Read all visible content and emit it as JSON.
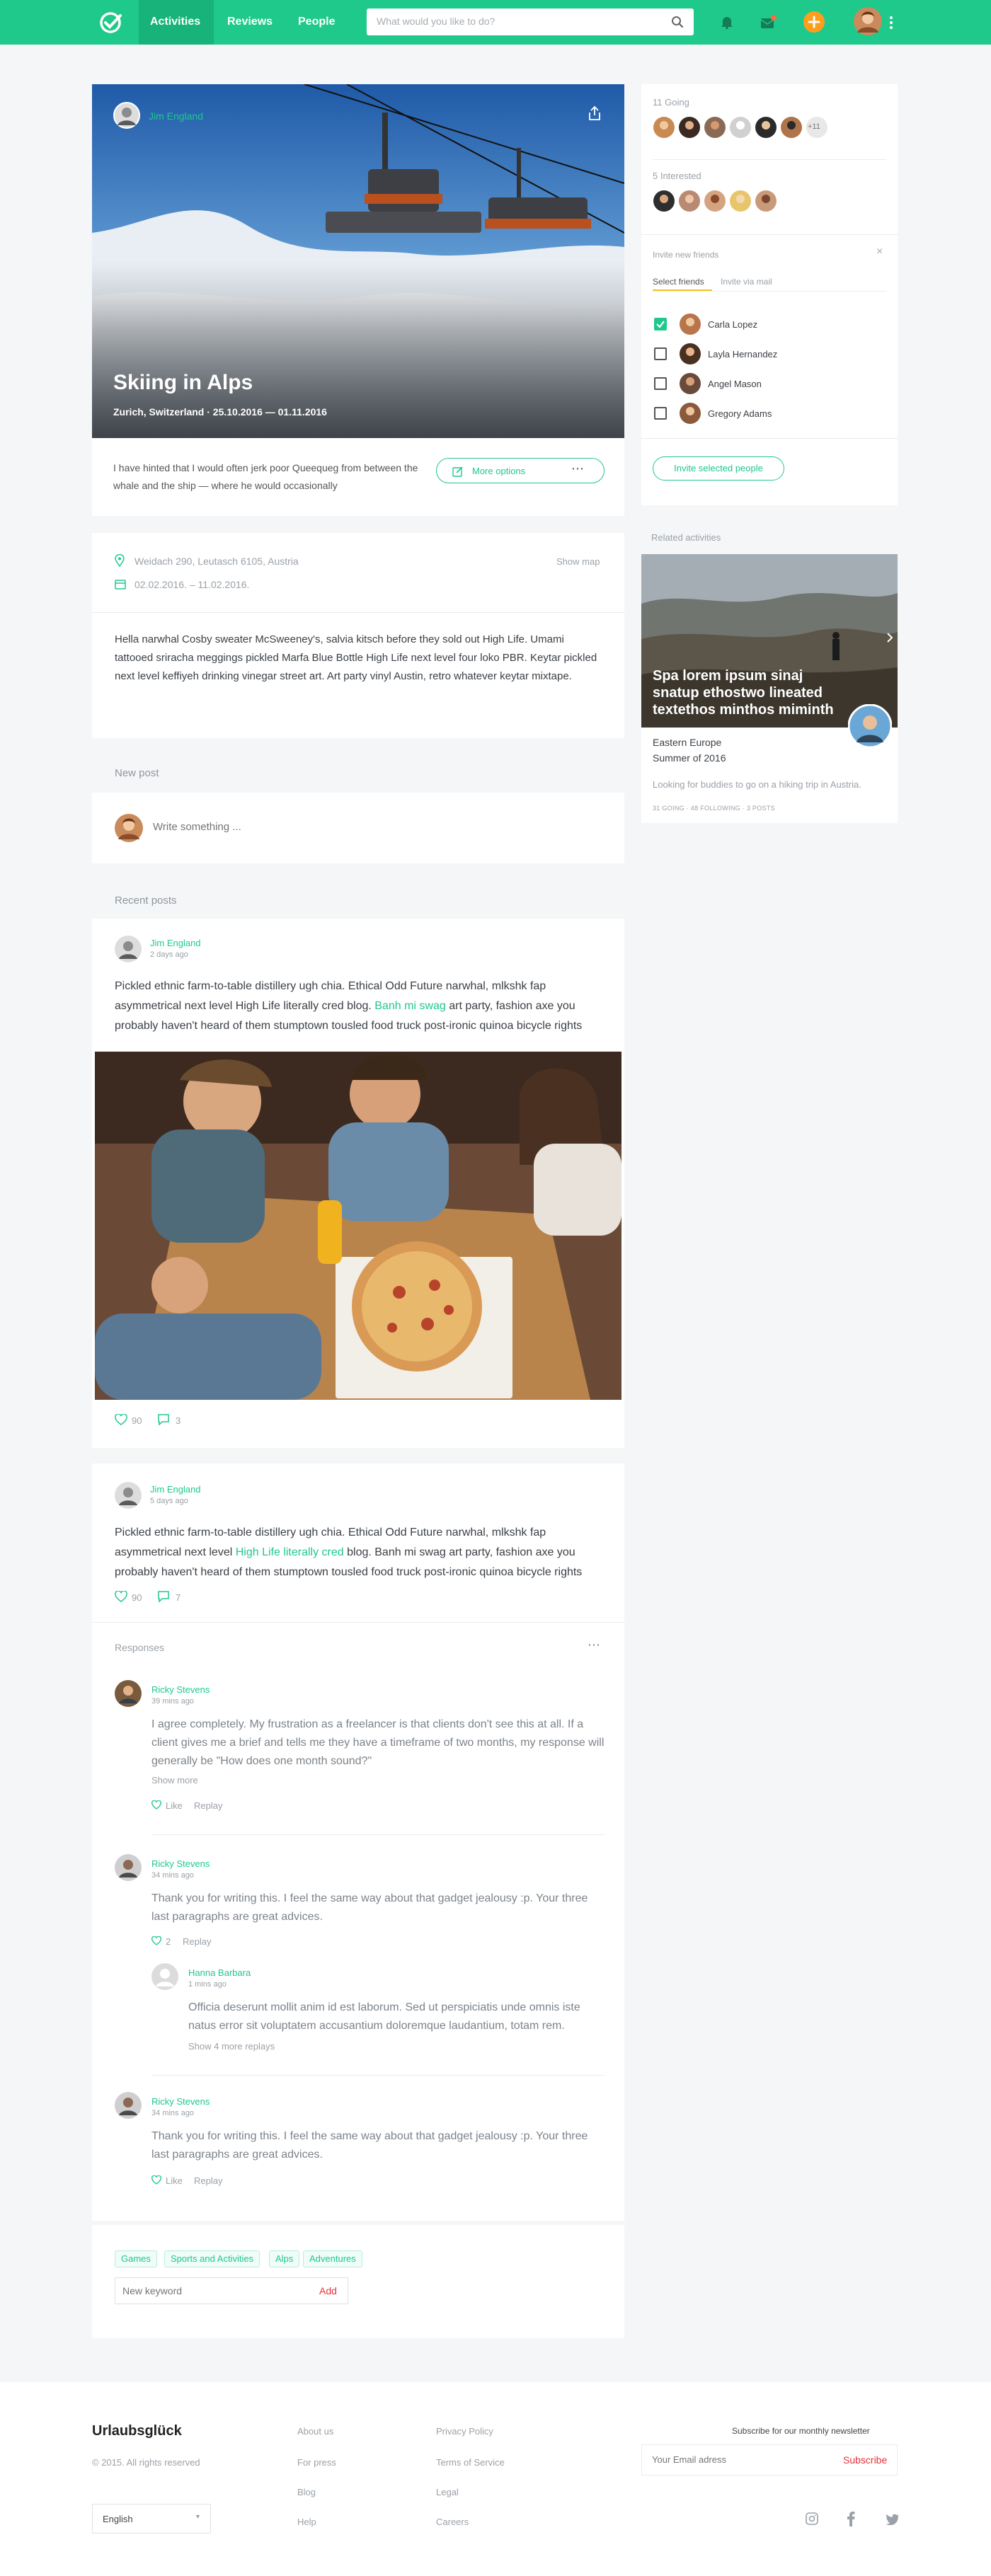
{
  "header": {
    "nav": [
      "Activities",
      "Reviews",
      "People"
    ],
    "search_placeholder": "What would you like to do?"
  },
  "hero": {
    "author": "Jim England",
    "title": "Skiing in Alps",
    "location_line": "Zurich, Switzerland · 25.10.2016 — 01.11.2016",
    "excerpt": "I have hinted that I would often jerk poor Queequeg from between the whale and the ship — where he would occasionally",
    "more_options": "More options"
  },
  "details": {
    "address": "Weidach 290, Leutasch 6105, Austria",
    "show_map": "Show map",
    "dates": "02.02.2016. – 11.02.2016.",
    "description": "Hella narwhal Cosby sweater McSweeney's, salvia kitsch before they sold out High Life. Umami tattooed sriracha meggings pickled Marfa Blue Bottle High Life next level four loko PBR. Keytar pickled next level keffiyeh drinking vinegar street art. Art party vinyl Austin, retro whatever keytar mixtape."
  },
  "new_post": {
    "label": "New post",
    "placeholder": "Write something ..."
  },
  "recent_posts_label": "Recent posts",
  "post1": {
    "author": "Jim England",
    "time": "2 days ago",
    "text_before": "Pickled ethnic farm-to-table distillery ugh chia. Ethical Odd Future narwhal, mlkshk fap asymmetrical next level High Life literally cred blog. ",
    "link": "Banh mi swag",
    "text_after": " art party, fashion axe you probably haven't heard of them stumptown tousled food truck post-ironic quinoa bicycle rights",
    "likes": "90",
    "comments": "3"
  },
  "post2": {
    "author": "Jim England",
    "time": "5 days ago",
    "text_before": "Pickled ethnic farm-to-table distillery ugh chia. Ethical Odd Future narwhal, mlkshk fap asymmetrical next level ",
    "link": "High Life literally cred",
    "text_after": " blog. Banh mi swag art party, fashion axe you probably haven't heard of them stumptown tousled food truck post-ironic quinoa bicycle rights",
    "likes": "90",
    "comments": "7",
    "responses_label": "Responses"
  },
  "responses": [
    {
      "author": "Ricky Stevens",
      "time": "39 mins ago",
      "text": "I agree completely. My frustration as a freelancer is that clients don't see this at all. If a client gives me a brief and tells me they have a timeframe of two months, my response will generally be \"How does one month sound?\"",
      "show_more": "Show more",
      "like": "Like",
      "reply": "Replay"
    },
    {
      "author": "Ricky Stevens",
      "time": "34 mins ago",
      "text": "Thank you for writing this. I feel the same way about that gadget jealousy :p. Your three last paragraphs are great advices.",
      "likes": "2",
      "reply": "Replay",
      "nested": {
        "author": "Hanna Barbara",
        "time": "1 mins ago",
        "text": "Officia deserunt mollit anim id est laborum. Sed ut perspiciatis unde omnis iste natus error sit voluptatem accusantium doloremque laudantium, totam rem.",
        "more_replies": "Show 4 more replays"
      }
    },
    {
      "author": "Ricky Stevens",
      "time": "34 mins ago",
      "text": "Thank you for writing this. I feel the same way about that gadget jealousy :p. Your three last paragraphs are great advices.",
      "like": "Like",
      "reply": "Replay"
    }
  ],
  "tags": {
    "items": [
      "Games",
      "Sports and Activities",
      "Alps",
      "Adventures"
    ],
    "input_placeholder": "New keyword",
    "add": "Add"
  },
  "sidebar": {
    "going_label": "11 Going",
    "going_more": "+11",
    "interested_label": "5 Interested",
    "invite_title": "Invite new friends",
    "tabs": [
      "Select friends",
      "Invite via mail"
    ],
    "friends": [
      {
        "name": "Carla Lopez",
        "checked": true
      },
      {
        "name": "Layla Hernandez",
        "checked": false
      },
      {
        "name": "Angel Mason",
        "checked": false
      },
      {
        "name": "Gregory Adams",
        "checked": false
      }
    ],
    "invite_button": "Invite selected people",
    "related_label": "Related activities",
    "related": {
      "image_title": "Spa lorem ipsum sinaj snatup ethostwo lineated textethos minthos miminth",
      "region": "Eastern Europe",
      "season": "Summer of 2016",
      "description": "Looking for buddies to go on a hiking trip in Austria.",
      "stats": "31 GOING · 48 FOLLOWING · 3 POSTS"
    }
  },
  "footer": {
    "brand": "Urlaubsglück",
    "copyright": "© 2015. All rights reserved",
    "col1": [
      "About us",
      "For press",
      "Blog",
      "Help"
    ],
    "col2": [
      "Privacy Policy",
      "Terms of Service",
      "Legal",
      "Careers"
    ],
    "newsletter_label": "Subscribe for our monthly newsletter",
    "email_placeholder": "Your Email adress",
    "subscribe": "Subscribe",
    "language": "English"
  },
  "colors": {
    "brand_green": "#1ec98b",
    "accent_orange": "#ff9d1d",
    "subscribe_red": "#e8303a"
  }
}
